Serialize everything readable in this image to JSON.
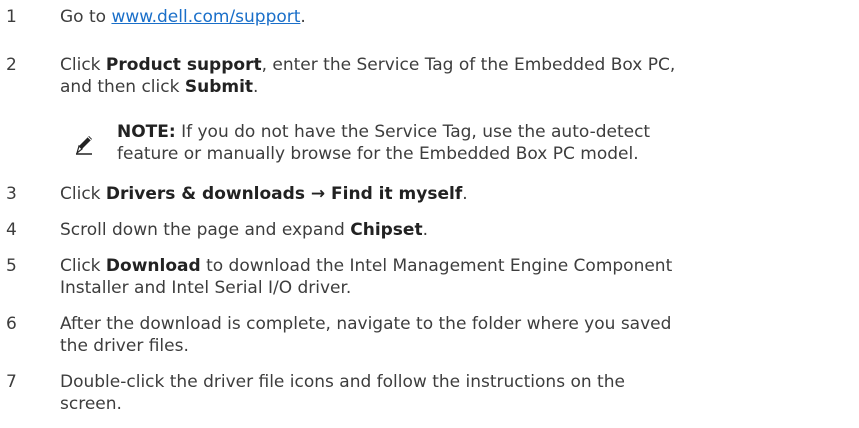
{
  "steps": [
    {
      "number": "1",
      "pre": "Go to ",
      "link": "www.dell.com/support",
      "post": "."
    },
    {
      "number": "2",
      "pre": "Click ",
      "b1": "Product support",
      "mid": ", enter the Service Tag of the Embedded Box PC,",
      "line2_pre": "and then click ",
      "b2": "Submit",
      "post": "."
    },
    {
      "number": "3",
      "pre": "Click ",
      "b1": "Drivers & downloads",
      "arrow": " → ",
      "b2": "Find it myself",
      "post": "."
    },
    {
      "number": "4",
      "pre": "Scroll down the page and expand ",
      "b1": "Chipset",
      "post": "."
    },
    {
      "number": "5",
      "pre": "Click ",
      "b1": "Download",
      "line1": " to download the Intel Management Engine Component",
      "line2": "Installer and Intel Serial I/O driver."
    },
    {
      "number": "6",
      "line1": "After the download is complete, navigate to the folder where you saved",
      "line2": "the driver files."
    },
    {
      "number": "7",
      "line1": "Double-click the driver file icons and follow the instructions on the",
      "line2": "screen."
    }
  ],
  "note": {
    "label": "NOTE:",
    "line1": " If you do not have the Service Tag, use the auto-detect",
    "line2": "feature or manually browse for the Embedded Box PC model."
  },
  "icons": {
    "note_icon": "pencil-note-icon"
  }
}
